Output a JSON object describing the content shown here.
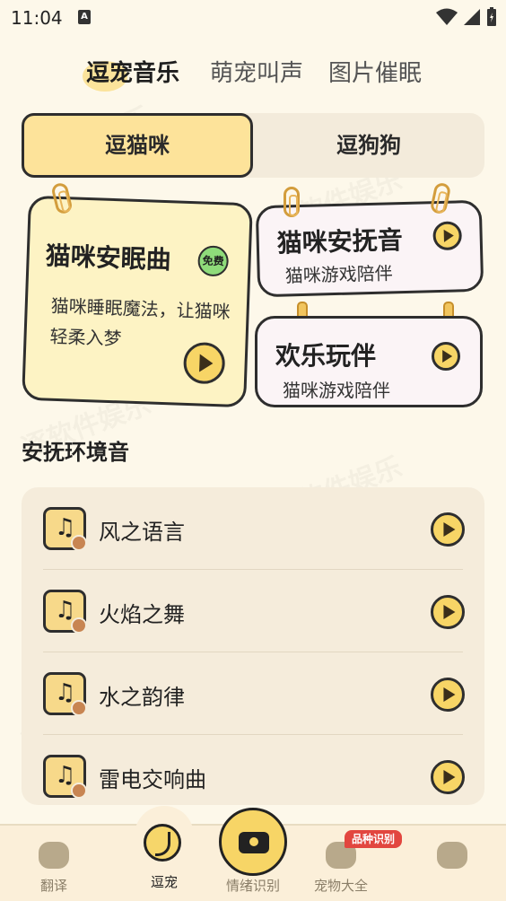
{
  "status_bar": {
    "time": "11:04",
    "notif_icon": "A"
  },
  "top_tabs": [
    {
      "label": "逗宠音乐"
    },
    {
      "label": "萌宠叫声"
    },
    {
      "label": "图片催眠"
    }
  ],
  "segment": {
    "active": "逗猫咪",
    "inactive": "逗狗狗"
  },
  "cards": {
    "big": {
      "title": "猫咪安眠曲",
      "badge": "免费",
      "desc": "猫咪睡眠魔法，让猫咪轻柔入梦"
    },
    "sm1": {
      "title": "猫咪安抚音",
      "sub": "猫咪游戏陪伴"
    },
    "sm2": {
      "title": "欢乐玩伴",
      "sub": "猫咪游戏陪伴"
    }
  },
  "section": {
    "title": "安抚环境音"
  },
  "ambient_list": [
    {
      "name": "风之语言"
    },
    {
      "name": "火焰之舞"
    },
    {
      "name": "水之韵律"
    },
    {
      "name": "雷电交响曲"
    }
  ],
  "bottom_nav": {
    "items": [
      {
        "label": "翻译"
      },
      {
        "label": "逗宠"
      },
      {
        "label": "情绪识别"
      },
      {
        "label": "宠物大全"
      }
    ],
    "badge": "品种识别"
  },
  "colors": {
    "accent": "#f7d566",
    "background": "#fdf8ea",
    "panel": "#f5ecdb"
  }
}
